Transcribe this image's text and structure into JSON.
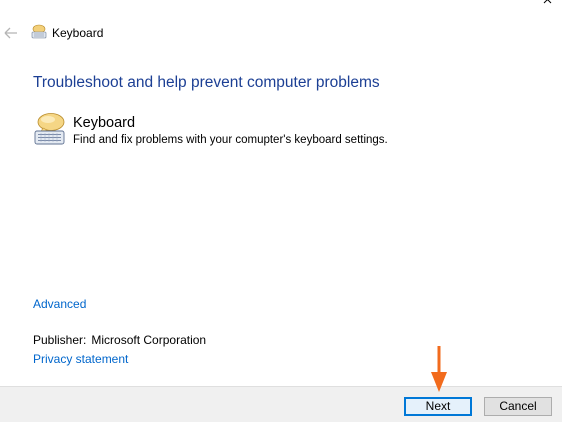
{
  "window": {
    "title": "Keyboard",
    "close_icon": "close-icon",
    "back_icon": "back-arrow-icon"
  },
  "main": {
    "heading": "Troubleshoot and help prevent computer problems",
    "item": {
      "title": "Keyboard",
      "description": "Find and fix problems with your comupter's keyboard settings.",
      "icon": "keyboard-troubleshooter-icon"
    },
    "advanced_link": "Advanced",
    "publisher_label": "Publisher:",
    "publisher_value": "Microsoft Corporation",
    "privacy_link": "Privacy statement"
  },
  "footer": {
    "next_label": "Next",
    "cancel_label": "Cancel"
  },
  "colors": {
    "heading": "#1c3f94",
    "link": "#0066cc",
    "annotation_arrow": "#f26b1d"
  }
}
